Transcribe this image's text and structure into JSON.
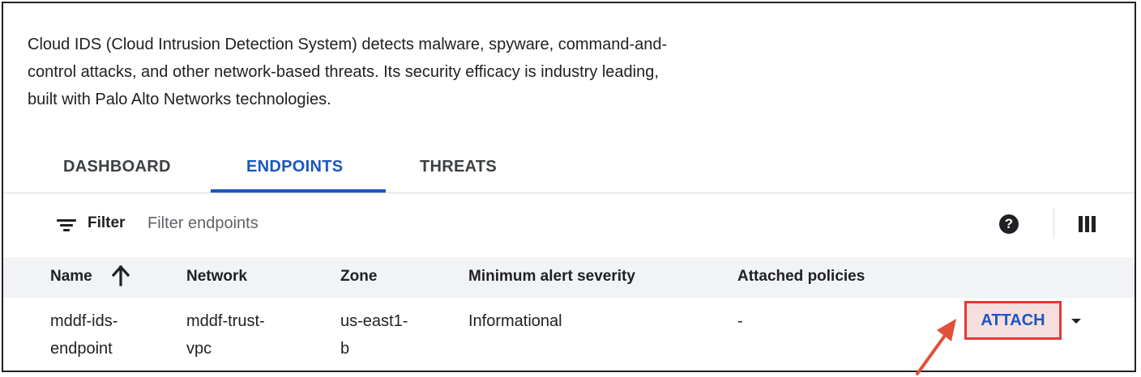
{
  "description": {
    "line1": "Cloud IDS (Cloud Intrusion Detection System) detects malware, spyware, command-and-",
    "line2": "control attacks, and other network-based threats. Its security efficacy is industry leading,",
    "line3": "built with Palo Alto Networks technologies."
  },
  "tabs": [
    {
      "label": "DASHBOARD",
      "active": false
    },
    {
      "label": "ENDPOINTS",
      "active": true
    },
    {
      "label": "THREATS",
      "active": false
    }
  ],
  "filter": {
    "label": "Filter",
    "placeholder": "Filter endpoints",
    "icon": "filter-list-icon"
  },
  "toolbar": {
    "help_icon": "help-icon",
    "help_glyph": "?",
    "columns_icon": "column-display-icon"
  },
  "table": {
    "columns": [
      "Name",
      "Network",
      "Zone",
      "Minimum alert severity",
      "Attached policies"
    ],
    "sort": {
      "column": "Name",
      "direction": "ascending",
      "icon": "arrow-upward-icon"
    },
    "rows": [
      {
        "name": [
          "mddf-ids-",
          "endpoint"
        ],
        "network": [
          "mddf-trust-",
          "vpc"
        ],
        "zone": [
          "us-east1-",
          "b"
        ],
        "severity": "Informational",
        "policies": "-",
        "action": "ATTACH"
      }
    ]
  },
  "colors": {
    "accent": "#1a56c2",
    "highlight_border": "#e53935",
    "highlight_fill": "#f7dede",
    "annotation_arrow": "#e0503a",
    "header_bg": "#f1f3f4"
  }
}
